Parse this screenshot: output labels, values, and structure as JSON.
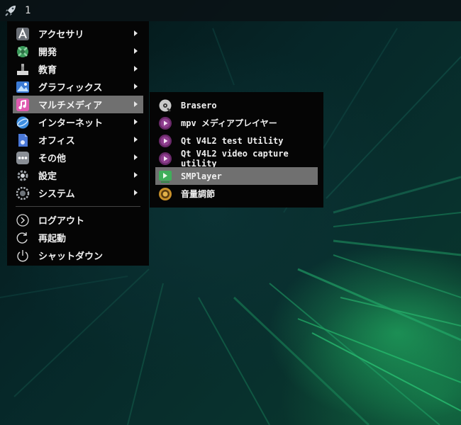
{
  "panel": {
    "workspace_number": "1",
    "launcher_icon": "rocket-icon"
  },
  "main_menu": {
    "items": [
      {
        "label": "アクセサリ",
        "icon": "accessories-icon",
        "submenu": true
      },
      {
        "label": "開発",
        "icon": "development-icon",
        "submenu": true
      },
      {
        "label": "教育",
        "icon": "education-icon",
        "submenu": true
      },
      {
        "label": "グラフィックス",
        "icon": "graphics-icon",
        "submenu": true
      },
      {
        "label": "マルチメディア",
        "icon": "multimedia-icon",
        "submenu": true,
        "active": true
      },
      {
        "label": "インターネット",
        "icon": "internet-icon",
        "submenu": true
      },
      {
        "label": "オフィス",
        "icon": "office-icon",
        "submenu": true
      },
      {
        "label": "その他",
        "icon": "other-icon",
        "submenu": true
      },
      {
        "label": "設定",
        "icon": "settings-icon",
        "submenu": true
      },
      {
        "label": "システム",
        "icon": "system-icon",
        "submenu": true
      }
    ],
    "session": [
      {
        "label": "ログアウト",
        "icon": "logout-icon"
      },
      {
        "label": "再起動",
        "icon": "reboot-icon"
      },
      {
        "label": "シャットダウン",
        "icon": "shutdown-icon"
      }
    ]
  },
  "submenu_multimedia": {
    "items": [
      {
        "label": "Brasero",
        "icon": "disc-burner-icon"
      },
      {
        "label": "mpv メディアプレイヤー",
        "icon": "media-player-icon"
      },
      {
        "label": "Qt V4L2 test Utility",
        "icon": "media-player-icon"
      },
      {
        "label": "Qt V4L2 video capture utility",
        "icon": "media-player-icon"
      },
      {
        "label": "SMPlayer",
        "icon": "smplayer-icon",
        "active": true
      },
      {
        "label": "音量調節",
        "icon": "volume-control-icon"
      }
    ]
  },
  "colors": {
    "menu_bg": "#050505",
    "highlight": "#707070",
    "multimedia_accent": "#e05ab0",
    "text": "#f0f0f0"
  }
}
